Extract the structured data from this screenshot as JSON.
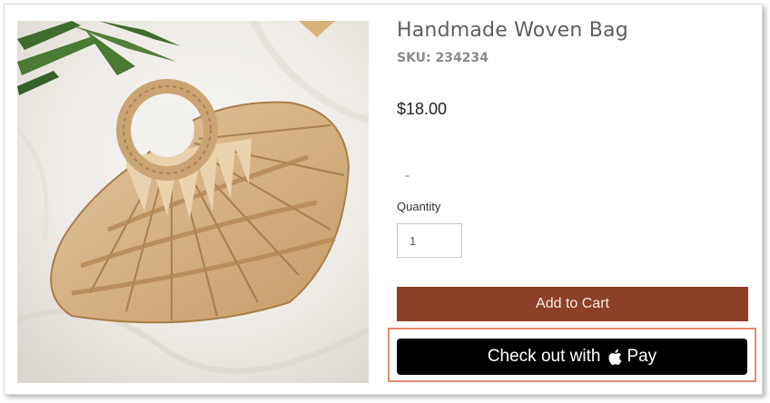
{
  "product": {
    "title": "Handmade Woven Bag",
    "sku": "SKU: 234234",
    "price": "$18.00",
    "image_alt": "Handmade woven straw bag"
  },
  "quantity": {
    "label": "Quantity",
    "value": "1"
  },
  "actions": {
    "add_to_cart_label": "Add to Cart",
    "apple_pay_prefix": "Check out with",
    "apple_pay_brand": "Pay"
  },
  "colors": {
    "add_to_cart_bg": "#8d3f28",
    "apple_pay_bg": "#000000",
    "highlight_border": "#e58a73"
  }
}
